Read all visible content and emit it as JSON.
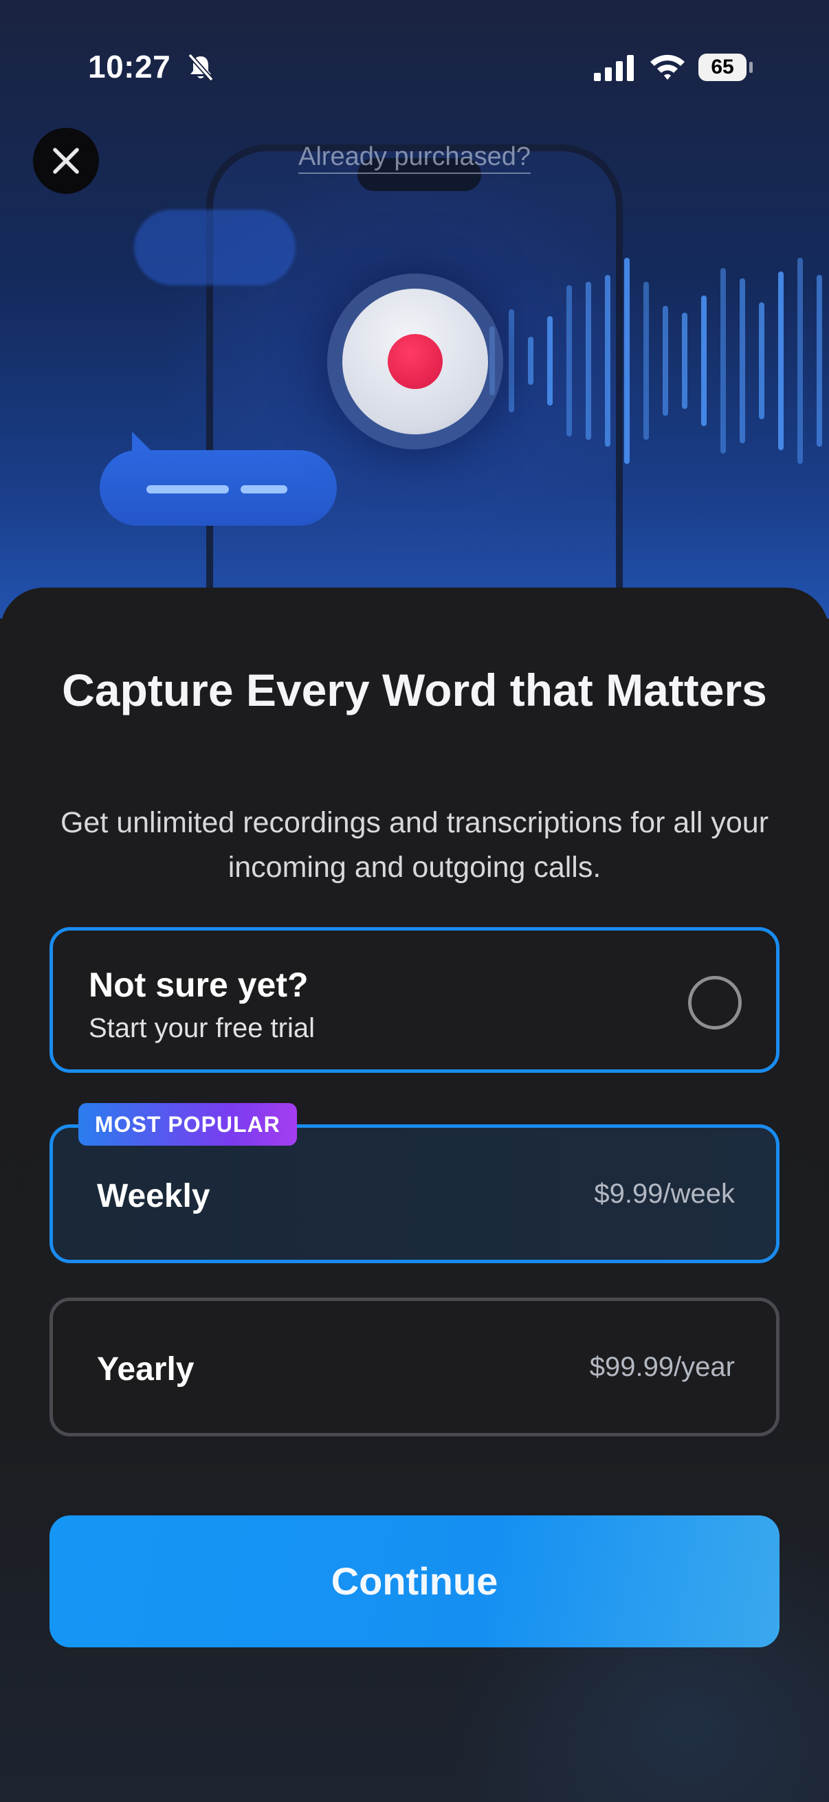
{
  "status_bar": {
    "time": "10:27",
    "battery": "65",
    "icons": [
      "bell-slash-icon",
      "cellular-signal-icon",
      "wifi-icon",
      "battery-icon"
    ]
  },
  "header": {
    "close_icon": "close-icon",
    "already_purchased": "Already purchased?"
  },
  "hero": {
    "icons": [
      "record-button-icon",
      "chat-bubble-icon",
      "audio-waveform-icon"
    ],
    "colors": {
      "record_dot": "#e0204d",
      "wave": "#4a8ff0"
    }
  },
  "paywall": {
    "title": "Capture Every Word that Matters",
    "subtitle": "Get unlimited recordings and transcriptions for all your incoming and outgoing calls.",
    "trial": {
      "title": "Not sure yet?",
      "subtitle": "Start your free trial"
    },
    "plans": [
      {
        "badge": "MOST POPULAR",
        "name": "Weekly",
        "price": "$9.99/week",
        "selected": true
      },
      {
        "name": "Yearly",
        "price": "$99.99/year",
        "selected": false
      }
    ],
    "continue_label": "Continue"
  },
  "colors": {
    "accent": "#1a8cf0",
    "sheet_background": "#1c1c1e",
    "badge_gradient": [
      "#2a7dee",
      "#a43ef0"
    ]
  }
}
